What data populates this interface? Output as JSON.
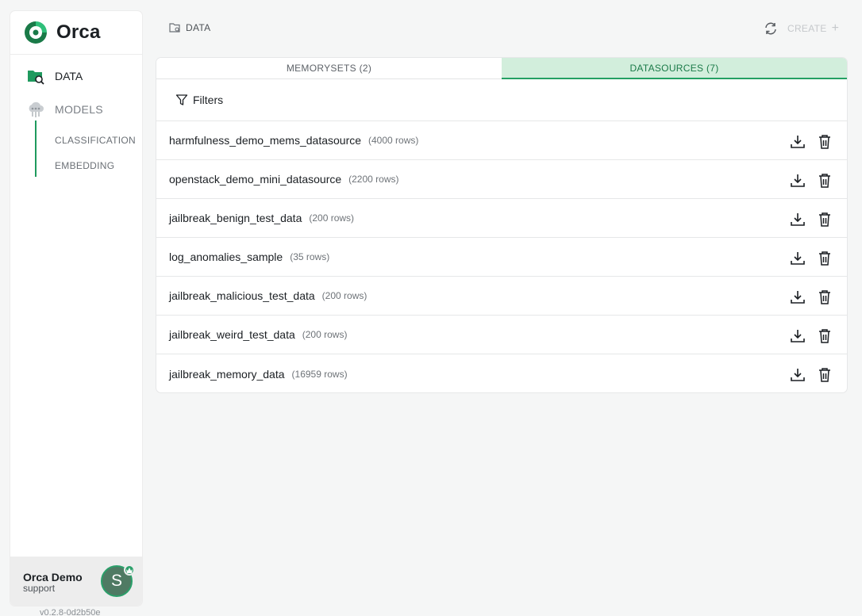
{
  "app": {
    "name": "Orca",
    "version": "v0.2.8-0d2b50e"
  },
  "sidebar": {
    "data_label": "DATA",
    "models_label": "MODELS",
    "sub_items": [
      "CLASSIFICATION",
      "EMBEDDING"
    ]
  },
  "user": {
    "name": "Orca Demo",
    "role": "support",
    "initial": "S"
  },
  "topbar": {
    "breadcrumb": "DATA",
    "create_label": "CREATE",
    "create_plus": "+"
  },
  "tabs": [
    {
      "label": "MEMORYSETS (2)",
      "active": false
    },
    {
      "label": "DATASOURCES (7)",
      "active": true
    }
  ],
  "filters_label": "Filters",
  "datasources": [
    {
      "name": "harmfulness_demo_mems_datasource",
      "rows": "(4000 rows)"
    },
    {
      "name": "openstack_demo_mini_datasource",
      "rows": "(2200 rows)"
    },
    {
      "name": "jailbreak_benign_test_data",
      "rows": "(200 rows)"
    },
    {
      "name": "log_anomalies_sample",
      "rows": "(35 rows)"
    },
    {
      "name": "jailbreak_malicious_test_data",
      "rows": "(200 rows)"
    },
    {
      "name": "jailbreak_weird_test_data",
      "rows": "(200 rows)"
    },
    {
      "name": "jailbreak_memory_data",
      "rows": "(16959 rows)"
    }
  ],
  "colors": {
    "accent": "#24a063",
    "active_tab_bg": "#d2eedc",
    "active_tab_text": "#1a7a48"
  }
}
